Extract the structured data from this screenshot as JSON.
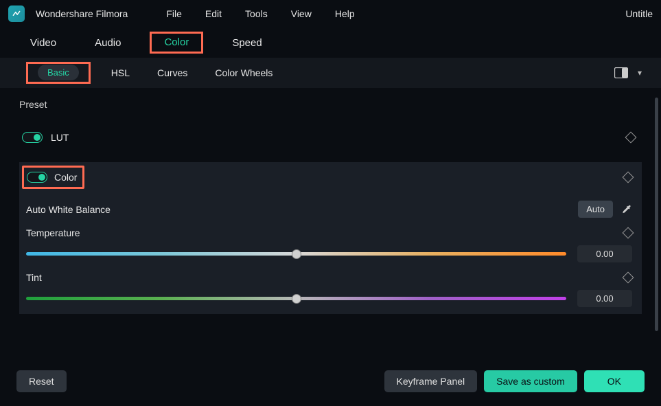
{
  "app": {
    "name": "Wondershare Filmora",
    "doc_title": "Untitle"
  },
  "menubar": {
    "file": "File",
    "edit": "Edit",
    "tools": "Tools",
    "view": "View",
    "help": "Help"
  },
  "main_tabs": {
    "video": "Video",
    "audio": "Audio",
    "color": "Color",
    "speed": "Speed",
    "active": "color"
  },
  "sub_tabs": {
    "basic": "Basic",
    "hsl": "HSL",
    "curves": "Curves",
    "wheels": "Color Wheels",
    "active": "basic"
  },
  "panel": {
    "preset_label": "Preset",
    "lut": {
      "label": "LUT",
      "enabled": true
    },
    "color": {
      "label": "Color",
      "enabled": true
    },
    "awb": {
      "label": "Auto White Balance",
      "auto_btn": "Auto"
    },
    "temperature": {
      "label": "Temperature",
      "value": "0.00"
    },
    "tint": {
      "label": "Tint",
      "value": "0.00"
    }
  },
  "footer": {
    "reset": "Reset",
    "keyframe": "Keyframe Panel",
    "save_custom": "Save as custom",
    "ok": "OK"
  },
  "colors": {
    "accent": "#25d4a4",
    "highlight": "#ff6b52"
  }
}
